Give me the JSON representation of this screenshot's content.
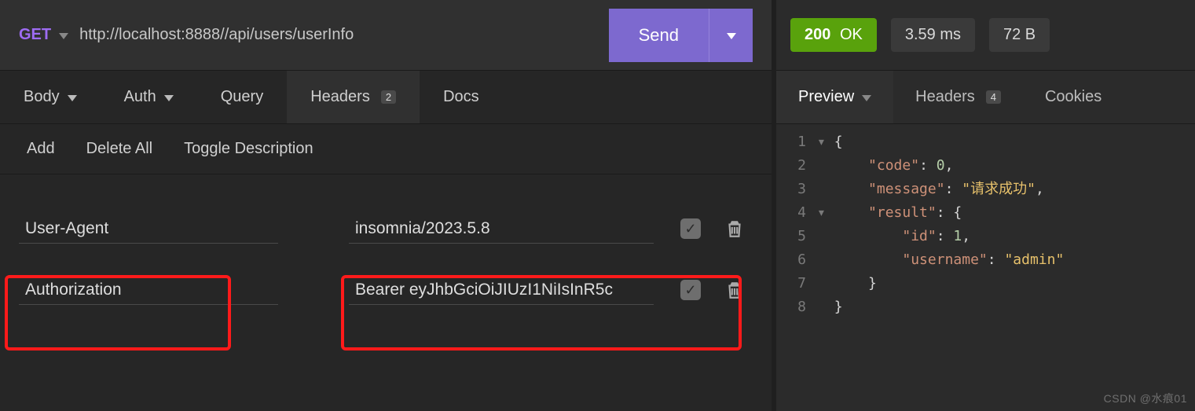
{
  "request": {
    "method": "GET",
    "url": "http://localhost:8888//api/users/userInfo",
    "send_label": "Send",
    "tabs": {
      "body": "Body",
      "auth": "Auth",
      "query": "Query",
      "headers": "Headers",
      "headers_count": "2",
      "docs": "Docs"
    },
    "toolbar": {
      "add": "Add",
      "delete_all": "Delete All",
      "toggle_desc": "Toggle Description"
    },
    "headers": [
      {
        "key": "User-Agent",
        "value": "insomnia/2023.5.8",
        "enabled": true
      },
      {
        "key": "Authorization",
        "value": "Bearer eyJhbGciOiJIUzI1NiIsInR5c",
        "enabled": true
      }
    ]
  },
  "response": {
    "status_code": "200",
    "status_text": "OK",
    "time": "3.59 ms",
    "size": "72 B",
    "tabs": {
      "preview": "Preview",
      "headers": "Headers",
      "headers_count": "4",
      "cookies": "Cookies"
    },
    "body_lines": [
      {
        "n": "1",
        "fold": "▾",
        "txt": [
          {
            "t": "{",
            "c": "br"
          }
        ]
      },
      {
        "n": "2",
        "txt": [
          {
            "t": "    \"code\"",
            "c": "key"
          },
          {
            "t": ": ",
            "c": "br"
          },
          {
            "t": "0",
            "c": "num"
          },
          {
            "t": ",",
            "c": "br"
          }
        ]
      },
      {
        "n": "3",
        "txt": [
          {
            "t": "    \"message\"",
            "c": "key"
          },
          {
            "t": ": ",
            "c": "br"
          },
          {
            "t": "\"请求成功\"",
            "c": "str"
          },
          {
            "t": ",",
            "c": "br"
          }
        ]
      },
      {
        "n": "4",
        "fold": "▾",
        "txt": [
          {
            "t": "    \"result\"",
            "c": "key"
          },
          {
            "t": ": ",
            "c": "br"
          },
          {
            "t": "{",
            "c": "br"
          }
        ]
      },
      {
        "n": "5",
        "txt": [
          {
            "t": "        \"id\"",
            "c": "key"
          },
          {
            "t": ": ",
            "c": "br"
          },
          {
            "t": "1",
            "c": "num"
          },
          {
            "t": ",",
            "c": "br"
          }
        ]
      },
      {
        "n": "6",
        "txt": [
          {
            "t": "        \"username\"",
            "c": "key"
          },
          {
            "t": ": ",
            "c": "br"
          },
          {
            "t": "\"admin\"",
            "c": "str"
          }
        ]
      },
      {
        "n": "7",
        "txt": [
          {
            "t": "    }",
            "c": "br"
          }
        ]
      },
      {
        "n": "8",
        "txt": [
          {
            "t": "}",
            "c": "br"
          }
        ]
      }
    ]
  },
  "watermark": "CSDN @水痕01"
}
